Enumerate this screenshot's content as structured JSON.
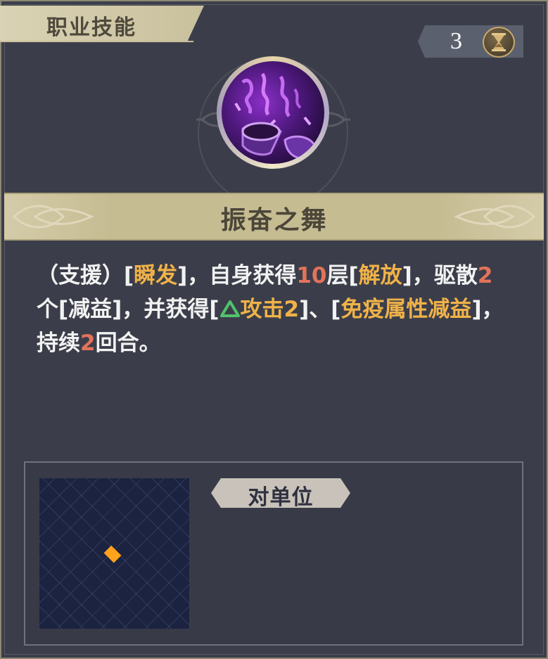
{
  "header": {
    "title": "职业技能"
  },
  "cooldown": {
    "value": "3",
    "icon": "hourglass-icon"
  },
  "skill": {
    "name": "振奋之舞",
    "icon": "dance-horn-icon"
  },
  "description": {
    "seg1": "（支援）[",
    "seg2": "瞬发",
    "seg3": "]，自身获得",
    "seg4": "10",
    "seg5": "层[",
    "seg6": "解放",
    "seg7": "]，驱散",
    "seg8": "2",
    "seg9": "个[减益]，并获得[",
    "seg10": "攻击2",
    "seg11": "]、[",
    "seg12": "免疫属性减益",
    "seg13": "]，持续",
    "seg14": "2",
    "seg15": "回合。"
  },
  "target": {
    "label": "对单位"
  },
  "colors": {
    "highlight_gold": "#f0b248",
    "highlight_number": "#e2735a",
    "buff_green": "#4fc46a",
    "target_marker": "#ffa21c"
  }
}
